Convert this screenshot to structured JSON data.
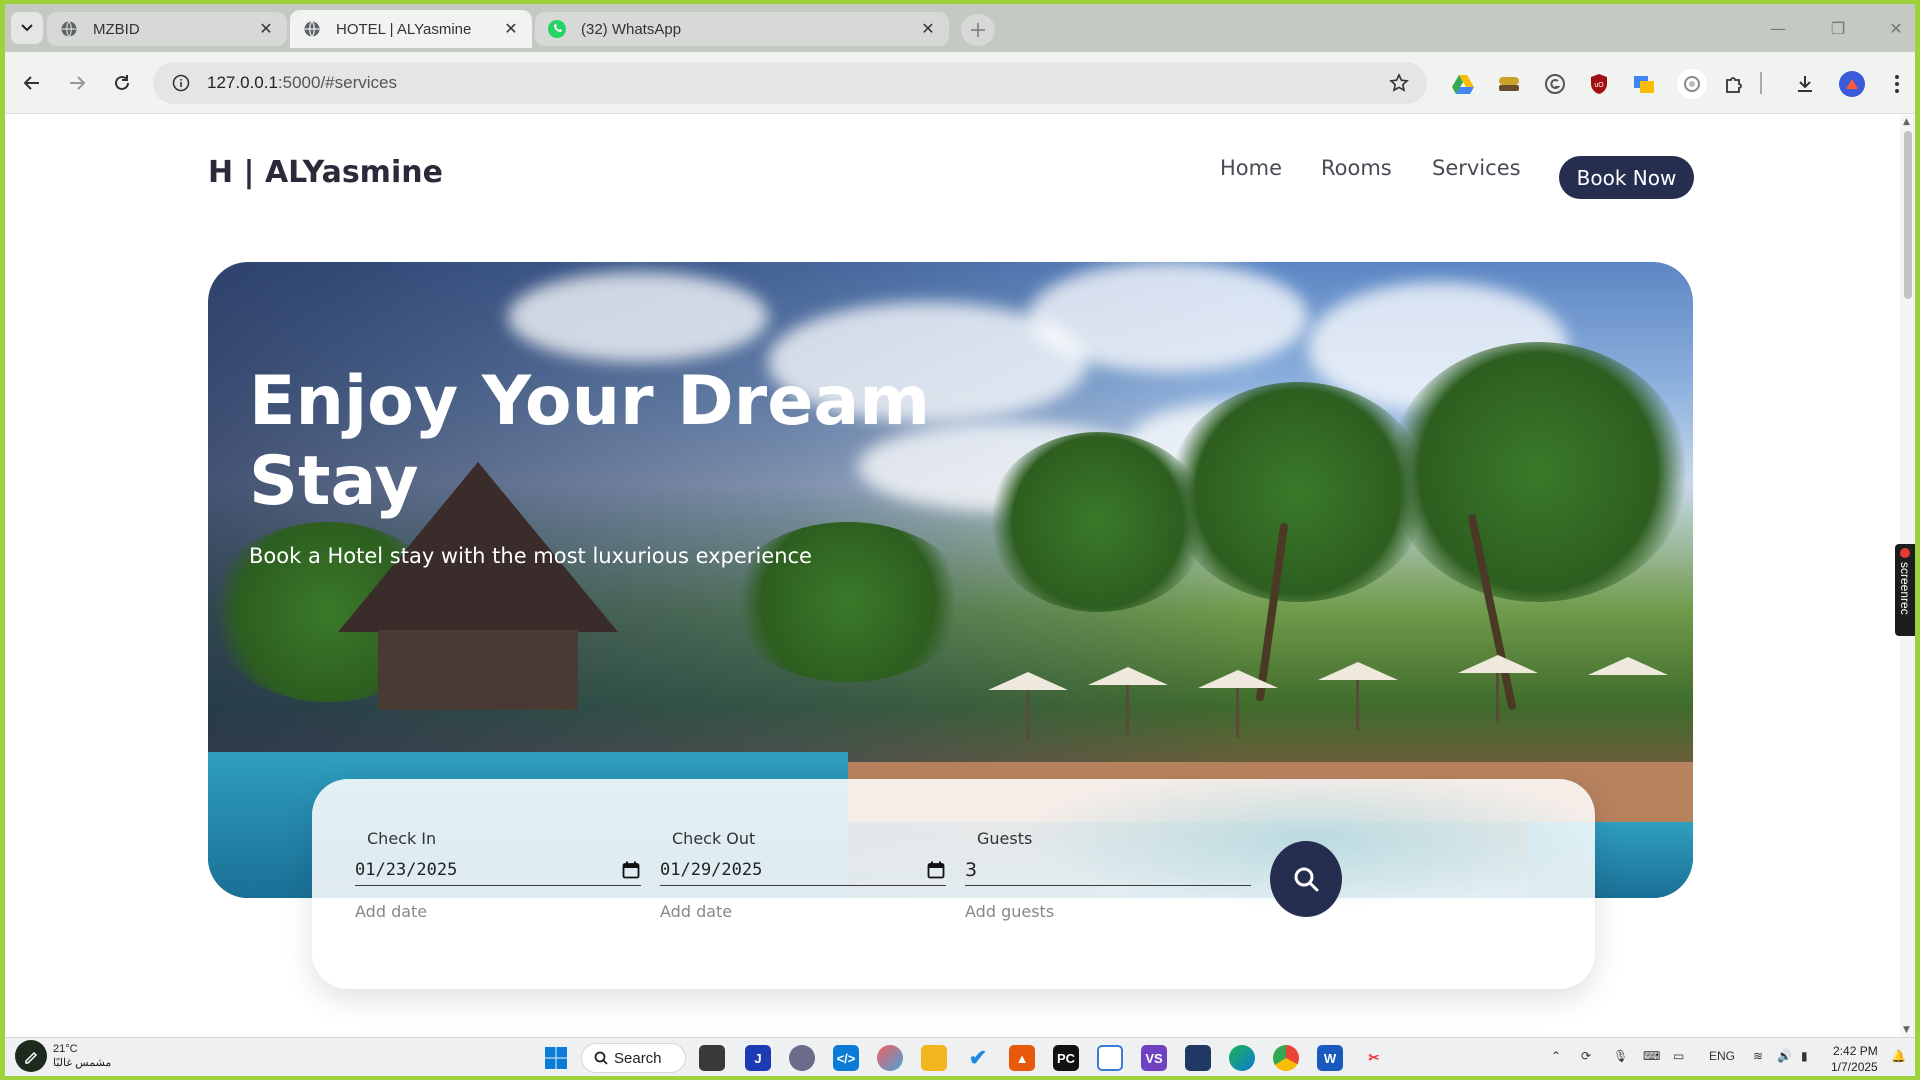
{
  "browser": {
    "tabs": [
      {
        "title": "MZBID",
        "active": false
      },
      {
        "title": "HOTEL | ALYasmine",
        "active": true
      },
      {
        "title": "(32) WhatsApp",
        "active": false
      }
    ],
    "url_host": "127.0.0.1",
    "url_rest": ":5000/#services"
  },
  "site": {
    "brand": "H | ALYasmine",
    "nav": {
      "home": "Home",
      "rooms": "Rooms",
      "services": "Services",
      "book_now": "Book Now"
    },
    "hero": {
      "title_line1": "Enjoy Your Dream",
      "title_line2": "Stay",
      "subtitle": "Book a Hotel stay with the most luxurious experience"
    },
    "booking": {
      "check_in": {
        "label": "Check In",
        "value": "01/23/2025",
        "hint": "Add date"
      },
      "check_out": {
        "label": "Check Out",
        "value": "01/29/2025",
        "hint": "Add date"
      },
      "guests": {
        "label": "Guests",
        "value": "3",
        "hint": "Add guests"
      }
    }
  },
  "overlay": {
    "screenrec": "screenrec"
  },
  "taskbar": {
    "weather_temp": "21°C",
    "weather_desc": "مشمس غالبًا",
    "search_label": "Search",
    "lang": "ENG",
    "time": "2:42 PM",
    "date": "1/7/2025"
  },
  "colors": {
    "primary": "#262e4f",
    "window_border": "#9fd13a",
    "tabstrip": "#c4c9c4"
  }
}
